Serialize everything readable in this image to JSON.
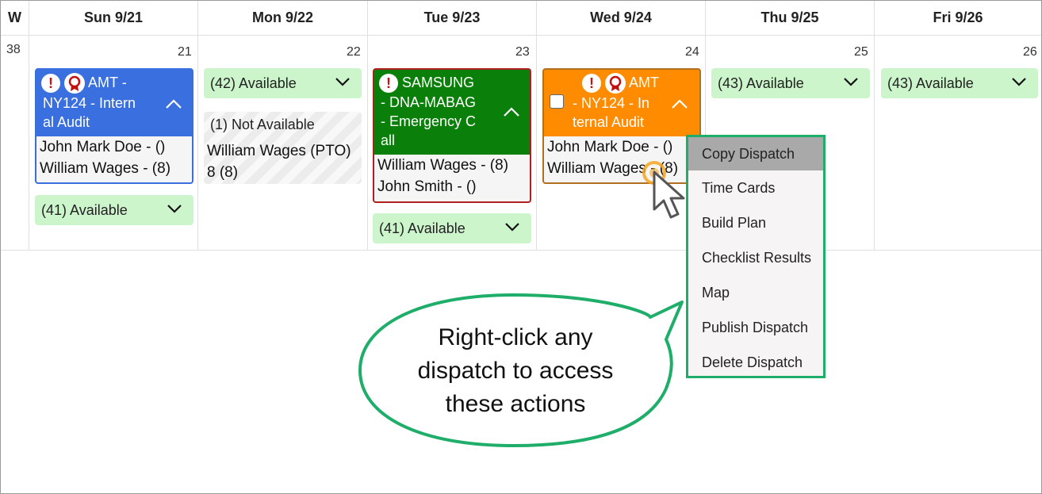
{
  "calendar": {
    "week_header": "W",
    "week_number": "38",
    "days": [
      {
        "label": "Sun 9/21",
        "num": "21"
      },
      {
        "label": "Mon 9/22",
        "num": "22"
      },
      {
        "label": "Tue 9/23",
        "num": "23"
      },
      {
        "label": "Wed 9/24",
        "num": "24"
      },
      {
        "label": "Thu 9/25",
        "num": "25"
      },
      {
        "label": "Fri 9/26",
        "num": "26"
      }
    ]
  },
  "sun": {
    "card": {
      "title_lines": [
        "AMT -",
        "NY124 - Intern",
        "al Audit"
      ],
      "assignees": [
        "John Mark Doe - ()",
        "William Wages - (8)"
      ],
      "color": "#3a6fe0"
    },
    "available": "(41) Available"
  },
  "mon": {
    "available": "(42) Available",
    "not_available": {
      "label": "(1) Not Available",
      "lines": [
        "William Wages (PTO)",
        "8 (8)"
      ]
    }
  },
  "tue": {
    "card": {
      "title_lines": [
        "SAMSUNG",
        "- DNA-MABAG",
        "- Emergency C",
        "all"
      ],
      "assignees": [
        "William Wages - (8)",
        "John Smith - ()"
      ],
      "color": "#0a800a"
    },
    "available": "(41) Available"
  },
  "wed": {
    "card": {
      "title_lines": [
        "AMT",
        "- NY124 - In",
        "ternal Audit"
      ],
      "assignees": [
        "John Mark Doe - ()",
        "William Wages - (8)"
      ],
      "color": "#ff8c00"
    }
  },
  "thu": {
    "available": "(43) Available"
  },
  "fri": {
    "available": "(43) Available"
  },
  "context_menu": {
    "items": [
      "Copy Dispatch",
      "Time Cards",
      "Build Plan",
      "Checklist Results",
      "Map",
      "Publish Dispatch",
      "Delete Dispatch"
    ],
    "highlighted_index": 0
  },
  "callout": {
    "lines": [
      "Right-click any",
      "dispatch to access",
      "these actions"
    ]
  },
  "colors": {
    "available_bg": "#ccf5cc",
    "menu_border": "#1fae6a",
    "alert_red": "#d01010"
  }
}
